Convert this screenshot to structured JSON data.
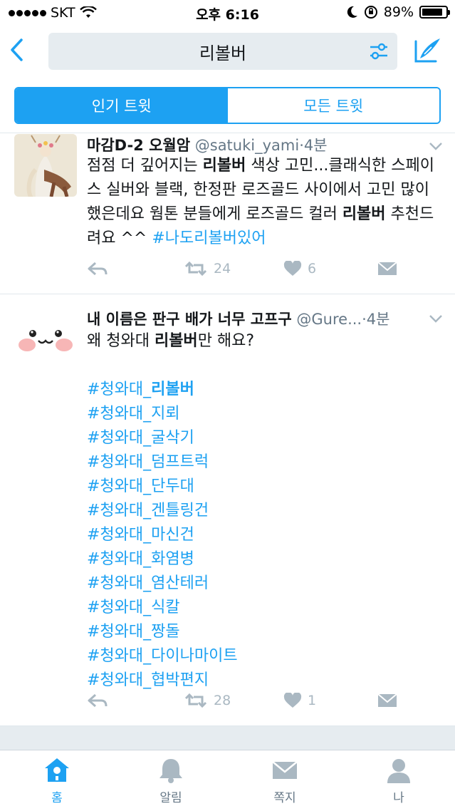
{
  "status_bar": {
    "carrier": "SKT",
    "time": "오후 6:16",
    "battery": "89%",
    "battery_level": 0.89
  },
  "nav": {
    "search_query": "리볼버"
  },
  "segments": {
    "popular": "인기 트윗",
    "all": "모든 트윗"
  },
  "tweets": [
    {
      "name": "마감D-2 오월암",
      "handle": "@satuki_yami",
      "dot": "·",
      "time": "4분",
      "body_segments": [
        {
          "text": "점점 더 깊어지는 ",
          "style": "normal"
        },
        {
          "text": "리볼버",
          "style": "bold"
        },
        {
          "text": " 색상 고민...클래식한 스페이스 실버와 블랙, 한정판 로즈골드 사이에서 고민 많이 했은데요 웜톤 분들에게 로즈골드 컬러 ",
          "style": "normal"
        },
        {
          "text": "리볼버",
          "style": "bold"
        },
        {
          "text": " 추천드려요 ^^ ",
          "style": "normal"
        },
        {
          "text": "#나도리볼버있어",
          "style": "hash"
        }
      ],
      "retweets": "24",
      "likes": "6"
    },
    {
      "name": "내 이름은 판구 배가 너무 고프구",
      "handle": "@Gure...",
      "dot": "·",
      "time": "4분",
      "body_pre": "왜 청와대 ",
      "body_bold": "리볼버",
      "body_post": "만 해요?",
      "hashtags": [
        "#청와대_리볼버",
        "#청와대_지뢰",
        "#청와대_굴삭기",
        "#청와대_덤프트럭",
        "#청와대_단두대",
        "#청와대_겐틀링건",
        "#청와대_마신건",
        "#청와대_화염병",
        "#청와대_염산테러",
        "#청와대_식칼",
        "#청와대_짱돌",
        "#청와대_다이나마이트",
        "#청와대_협박편지"
      ],
      "retweets": "28",
      "likes": "1"
    }
  ],
  "tabbar": {
    "home": "홈",
    "notifications": "알림",
    "messages": "쪽지",
    "me": "나"
  },
  "colors": {
    "accent": "#1da1f2",
    "muted": "#aab8c2",
    "text": "#14171a",
    "secondary": "#657786"
  }
}
